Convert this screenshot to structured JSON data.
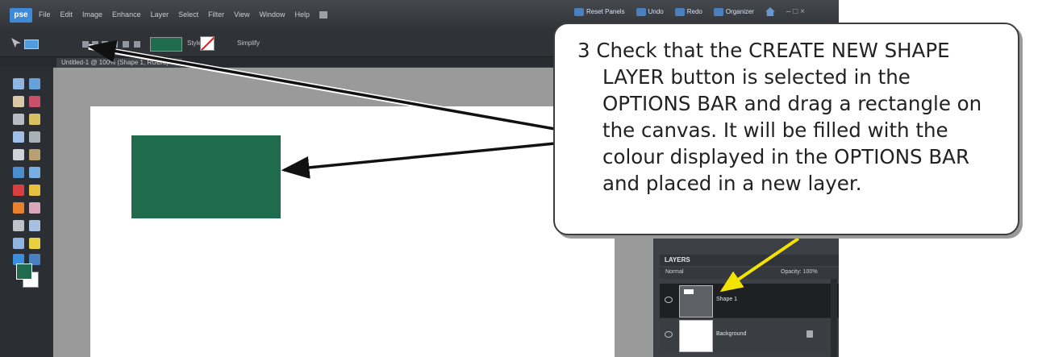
{
  "app": {
    "logo": "pse",
    "menus": [
      "File",
      "Edit",
      "Image",
      "Enhance",
      "Layer",
      "Select",
      "Filter",
      "View",
      "Window",
      "Help"
    ],
    "buttons": {
      "reset_panels": "Reset Panels",
      "undo": "Undo",
      "redo": "Redo",
      "organizer": "Organizer"
    },
    "window_controls": "– □ ×"
  },
  "options_bar": {
    "style_label": "Style:",
    "simplify_label": "Simplify",
    "shape_color": "#1e6b4e"
  },
  "document": {
    "tab_title": "Untitled-1 @ 100% (Shape 1, RGB/8)",
    "shape_color": "#1e6b4e"
  },
  "layers_panel": {
    "header": "LAYERS",
    "blend_mode": "Normal",
    "opacity_label": "Opacity:",
    "opacity_value": "100%",
    "layers": [
      {
        "name": "Shape 1"
      },
      {
        "name": "Background"
      }
    ]
  },
  "callout": {
    "text": "3  Check that the CREATE NEW SHAPE LAYER button is selected in the OPTIONS BAR and drag a rectangle on the canvas.  It will be filled with the colour displayed in the OPTIONS BAR and placed in a new layer."
  },
  "colors": {
    "arrow_black": "#111111",
    "arrow_yellow": "#f2e400"
  }
}
